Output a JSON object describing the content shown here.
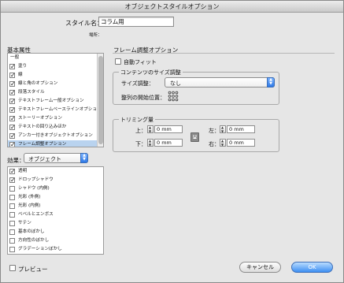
{
  "window": {
    "title": "オブジェクトスタイルオプション"
  },
  "style_name": {
    "label": "スタイル名：",
    "value": "コラム用"
  },
  "location": {
    "label": "場所："
  },
  "basic_attributes": {
    "title": "基本属性",
    "items": [
      {
        "label": "一般",
        "checked": false,
        "has_checkbox": false
      },
      {
        "label": "塗り",
        "checked": true,
        "has_checkbox": true
      },
      {
        "label": "線",
        "checked": true,
        "has_checkbox": true
      },
      {
        "label": "線と角のオプション",
        "checked": true,
        "has_checkbox": true
      },
      {
        "label": "段落スタイル",
        "checked": true,
        "has_checkbox": true
      },
      {
        "label": "テキストフレーム一般オプション",
        "checked": true,
        "has_checkbox": true
      },
      {
        "label": "テキストフレームベースラインオプション",
        "checked": true,
        "has_checkbox": true
      },
      {
        "label": "ストーリーオプション",
        "checked": true,
        "has_checkbox": true
      },
      {
        "label": "テキストの回り込みほか",
        "checked": true,
        "has_checkbox": true
      },
      {
        "label": "アンカー付きオブジェクトオプション",
        "checked": true,
        "has_checkbox": true
      },
      {
        "label": "フレーム調整オプション",
        "checked": true,
        "has_checkbox": true
      }
    ]
  },
  "effects": {
    "label": "効果：",
    "select_value": "オブジェクト",
    "items": [
      {
        "label": "透明",
        "checked": true
      },
      {
        "label": "ドロップシャドウ",
        "checked": true
      },
      {
        "label": "シャドウ (内側)",
        "checked": false
      },
      {
        "label": "光彩 (外側)",
        "checked": false
      },
      {
        "label": "光彩 (内側)",
        "checked": false
      },
      {
        "label": "ベベルとエンボス",
        "checked": false
      },
      {
        "label": "サテン",
        "checked": false
      },
      {
        "label": "基本のぼかし",
        "checked": false
      },
      {
        "label": "方向性のぼかし",
        "checked": false
      },
      {
        "label": "グラデーションぼかし",
        "checked": false
      }
    ]
  },
  "frame_fitting": {
    "title": "フレーム調整オプション",
    "auto_fit": {
      "label": "自動フィット",
      "checked": false
    },
    "content_fit": {
      "title": "コンテンツのサイズ調整",
      "size_label": "サイズ調整：",
      "size_value": "なし",
      "align_label": "整列の開始位置："
    },
    "crop": {
      "title": "トリミング量",
      "top_label": "上：",
      "top_value": "0 mm",
      "bottom_label": "下：",
      "bottom_value": "0 mm",
      "left_label": "左：",
      "left_value": "0 mm",
      "right_label": "右：",
      "right_value": "0 mm"
    }
  },
  "footer": {
    "preview_label": "プレビュー",
    "preview_checked": false,
    "cancel_label": "キャンセル",
    "ok_label": "OK"
  }
}
